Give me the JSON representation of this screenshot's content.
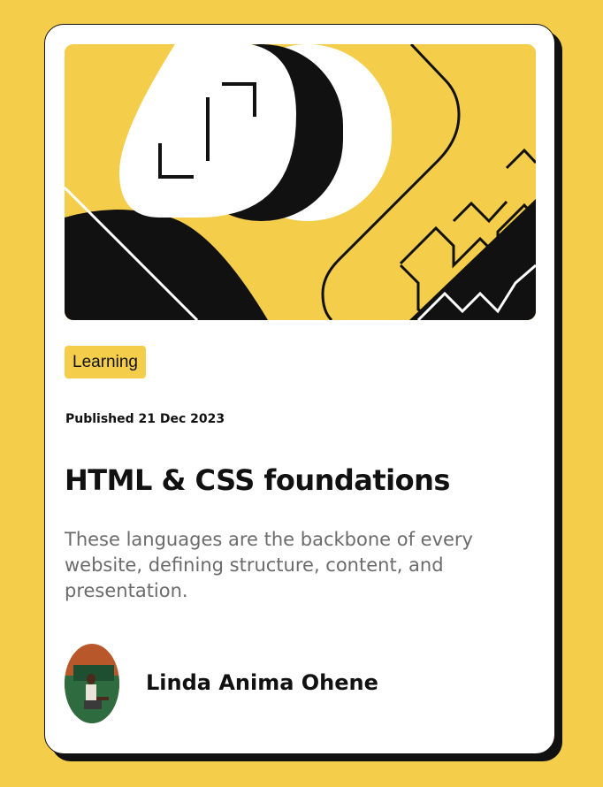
{
  "card": {
    "tag": "Learning",
    "published": "Published 21 Dec 2023",
    "title": "HTML & CSS foundations",
    "description": "These languages are the backbone of every website, defining structure, content, and presentation.",
    "author": {
      "name": "Linda Anima Ohene"
    }
  },
  "colors": {
    "background": "#f4ce4b",
    "card": "#ffffff",
    "ink": "#111111",
    "muted_text": "#6b6b6b"
  },
  "icons": {
    "hero": "abstract-illustration",
    "avatar": "author-avatar"
  }
}
